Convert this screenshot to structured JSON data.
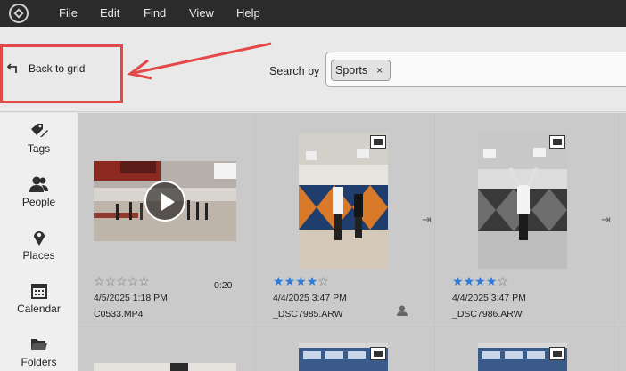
{
  "menu": {
    "items": [
      "File",
      "Edit",
      "Find",
      "View",
      "Help"
    ]
  },
  "toolbar": {
    "back_label": "Back to grid",
    "search_label": "Search by",
    "search_chip": "Sports",
    "chip_close": "×"
  },
  "sidebar": {
    "items": [
      {
        "label": "Tags",
        "icon": "tag-pen-icon"
      },
      {
        "label": "People",
        "icon": "people-icon"
      },
      {
        "label": "Places",
        "icon": "map-pin-icon"
      },
      {
        "label": "Calendar",
        "icon": "calendar-icon"
      },
      {
        "label": "Folders",
        "icon": "folder-icon"
      }
    ]
  },
  "grid": {
    "items": [
      {
        "stars": 0,
        "date": "4/5/2025 1:18 PM",
        "filename": "C0533.MP4",
        "duration": "0:20",
        "type": "video"
      },
      {
        "stars": 4,
        "date": "4/4/2025 3:47 PM",
        "filename": "_DSC7985.ARW",
        "type": "photo",
        "person_icon": true
      },
      {
        "stars": 4,
        "date": "4/4/2025 3:47 PM",
        "filename": "_DSC7986.ARW",
        "type": "photo"
      }
    ]
  },
  "colors": {
    "accent_star": "#2d7bd6",
    "highlight": "#e3494a"
  }
}
